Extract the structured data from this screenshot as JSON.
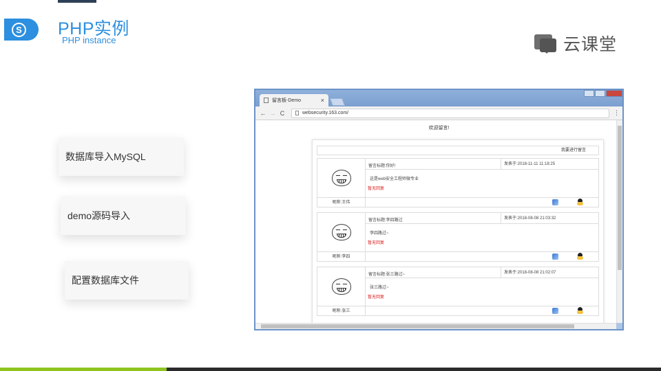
{
  "slide": {
    "title": "PHP实例",
    "subtitle": "PHP instance",
    "logo_glyph": "S",
    "brand": "云课堂",
    "accent_color": "#2c8fdf",
    "cards": [
      {
        "label": "数据库导入MySQL"
      },
      {
        "label": "demo源码导入"
      },
      {
        "label": "配置数据库文件"
      }
    ]
  },
  "browser": {
    "tab_title": "留言板-Demo",
    "tab_close": "×",
    "address": "websecurity.163.com/",
    "nav": {
      "back": "←",
      "forward": "→",
      "reload": "C",
      "menu": "⋮"
    },
    "page": {
      "heading": "欢迎留言!",
      "post_link": "我要进行留言",
      "messages": [
        {
          "subject": "留言标题:你好!",
          "time": "发表于:2018-11-11 11:18:25",
          "content": "这是web安全工程师微专业",
          "reply": "暂无回复",
          "nickname": "昵称:王伟"
        },
        {
          "subject": "留言标题:李四路过",
          "time": "发表于:2018-08-08 21:03:32",
          "content": "李四路过~",
          "reply": "暂无回复",
          "nickname": "昵称:李四"
        },
        {
          "subject": "留言标题:张三路过~",
          "time": "发表于:2018-08-08 21:02:07",
          "content": "张三路过~",
          "reply": "暂无回复",
          "nickname": "昵称:张三"
        }
      ]
    }
  }
}
